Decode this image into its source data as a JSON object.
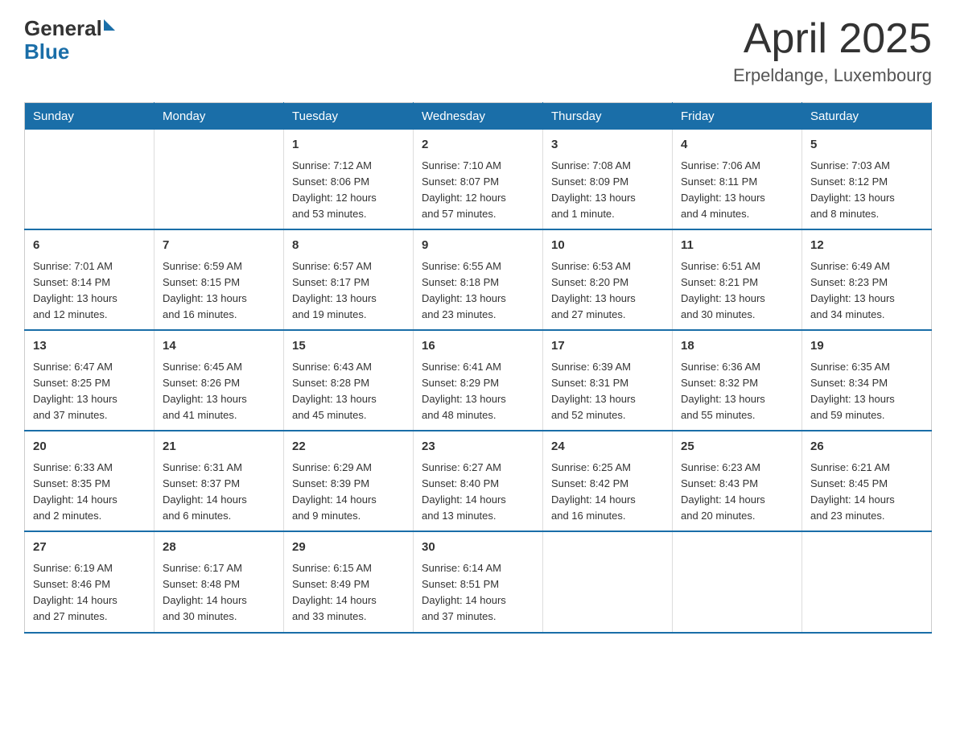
{
  "logo": {
    "general": "General",
    "blue": "Blue"
  },
  "title": "April 2025",
  "subtitle": "Erpeldange, Luxembourg",
  "days_of_week": [
    "Sunday",
    "Monday",
    "Tuesday",
    "Wednesday",
    "Thursday",
    "Friday",
    "Saturday"
  ],
  "weeks": [
    [
      {
        "day": "",
        "info": ""
      },
      {
        "day": "",
        "info": ""
      },
      {
        "day": "1",
        "info": "Sunrise: 7:12 AM\nSunset: 8:06 PM\nDaylight: 12 hours\nand 53 minutes."
      },
      {
        "day": "2",
        "info": "Sunrise: 7:10 AM\nSunset: 8:07 PM\nDaylight: 12 hours\nand 57 minutes."
      },
      {
        "day": "3",
        "info": "Sunrise: 7:08 AM\nSunset: 8:09 PM\nDaylight: 13 hours\nand 1 minute."
      },
      {
        "day": "4",
        "info": "Sunrise: 7:06 AM\nSunset: 8:11 PM\nDaylight: 13 hours\nand 4 minutes."
      },
      {
        "day": "5",
        "info": "Sunrise: 7:03 AM\nSunset: 8:12 PM\nDaylight: 13 hours\nand 8 minutes."
      }
    ],
    [
      {
        "day": "6",
        "info": "Sunrise: 7:01 AM\nSunset: 8:14 PM\nDaylight: 13 hours\nand 12 minutes."
      },
      {
        "day": "7",
        "info": "Sunrise: 6:59 AM\nSunset: 8:15 PM\nDaylight: 13 hours\nand 16 minutes."
      },
      {
        "day": "8",
        "info": "Sunrise: 6:57 AM\nSunset: 8:17 PM\nDaylight: 13 hours\nand 19 minutes."
      },
      {
        "day": "9",
        "info": "Sunrise: 6:55 AM\nSunset: 8:18 PM\nDaylight: 13 hours\nand 23 minutes."
      },
      {
        "day": "10",
        "info": "Sunrise: 6:53 AM\nSunset: 8:20 PM\nDaylight: 13 hours\nand 27 minutes."
      },
      {
        "day": "11",
        "info": "Sunrise: 6:51 AM\nSunset: 8:21 PM\nDaylight: 13 hours\nand 30 minutes."
      },
      {
        "day": "12",
        "info": "Sunrise: 6:49 AM\nSunset: 8:23 PM\nDaylight: 13 hours\nand 34 minutes."
      }
    ],
    [
      {
        "day": "13",
        "info": "Sunrise: 6:47 AM\nSunset: 8:25 PM\nDaylight: 13 hours\nand 37 minutes."
      },
      {
        "day": "14",
        "info": "Sunrise: 6:45 AM\nSunset: 8:26 PM\nDaylight: 13 hours\nand 41 minutes."
      },
      {
        "day": "15",
        "info": "Sunrise: 6:43 AM\nSunset: 8:28 PM\nDaylight: 13 hours\nand 45 minutes."
      },
      {
        "day": "16",
        "info": "Sunrise: 6:41 AM\nSunset: 8:29 PM\nDaylight: 13 hours\nand 48 minutes."
      },
      {
        "day": "17",
        "info": "Sunrise: 6:39 AM\nSunset: 8:31 PM\nDaylight: 13 hours\nand 52 minutes."
      },
      {
        "day": "18",
        "info": "Sunrise: 6:36 AM\nSunset: 8:32 PM\nDaylight: 13 hours\nand 55 minutes."
      },
      {
        "day": "19",
        "info": "Sunrise: 6:35 AM\nSunset: 8:34 PM\nDaylight: 13 hours\nand 59 minutes."
      }
    ],
    [
      {
        "day": "20",
        "info": "Sunrise: 6:33 AM\nSunset: 8:35 PM\nDaylight: 14 hours\nand 2 minutes."
      },
      {
        "day": "21",
        "info": "Sunrise: 6:31 AM\nSunset: 8:37 PM\nDaylight: 14 hours\nand 6 minutes."
      },
      {
        "day": "22",
        "info": "Sunrise: 6:29 AM\nSunset: 8:39 PM\nDaylight: 14 hours\nand 9 minutes."
      },
      {
        "day": "23",
        "info": "Sunrise: 6:27 AM\nSunset: 8:40 PM\nDaylight: 14 hours\nand 13 minutes."
      },
      {
        "day": "24",
        "info": "Sunrise: 6:25 AM\nSunset: 8:42 PM\nDaylight: 14 hours\nand 16 minutes."
      },
      {
        "day": "25",
        "info": "Sunrise: 6:23 AM\nSunset: 8:43 PM\nDaylight: 14 hours\nand 20 minutes."
      },
      {
        "day": "26",
        "info": "Sunrise: 6:21 AM\nSunset: 8:45 PM\nDaylight: 14 hours\nand 23 minutes."
      }
    ],
    [
      {
        "day": "27",
        "info": "Sunrise: 6:19 AM\nSunset: 8:46 PM\nDaylight: 14 hours\nand 27 minutes."
      },
      {
        "day": "28",
        "info": "Sunrise: 6:17 AM\nSunset: 8:48 PM\nDaylight: 14 hours\nand 30 minutes."
      },
      {
        "day": "29",
        "info": "Sunrise: 6:15 AM\nSunset: 8:49 PM\nDaylight: 14 hours\nand 33 minutes."
      },
      {
        "day": "30",
        "info": "Sunrise: 6:14 AM\nSunset: 8:51 PM\nDaylight: 14 hours\nand 37 minutes."
      },
      {
        "day": "",
        "info": ""
      },
      {
        "day": "",
        "info": ""
      },
      {
        "day": "",
        "info": ""
      }
    ]
  ]
}
